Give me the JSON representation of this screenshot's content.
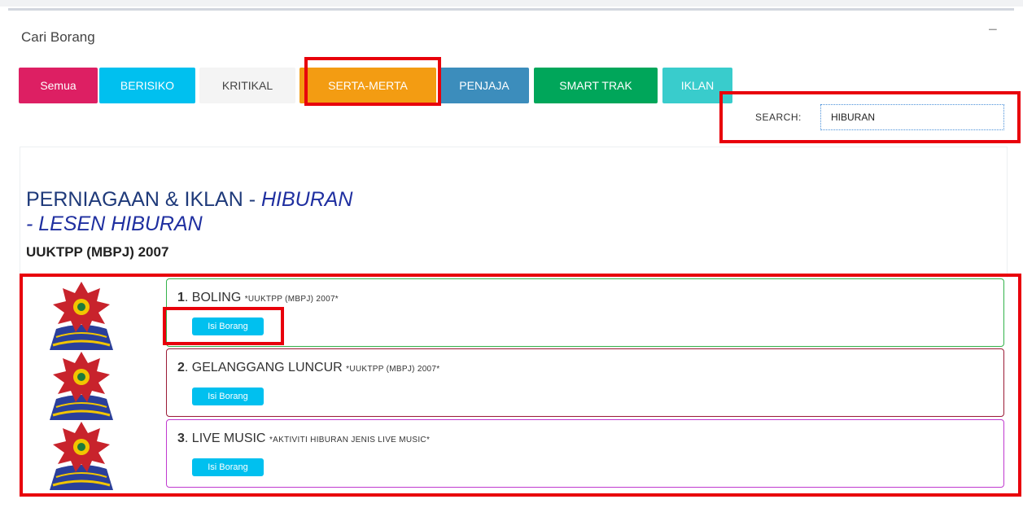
{
  "panel": {
    "title": "Cari Borang",
    "collapse_symbol": "−"
  },
  "tabs": [
    {
      "label": "Semua",
      "bg": "#dd1f63",
      "fg": "#ffffff"
    },
    {
      "label": "BERISIKO",
      "bg": "#00c0ef",
      "fg": "#ffffff"
    },
    {
      "label": "KRITIKAL",
      "bg": "#f4f4f4",
      "fg": "#444444"
    },
    {
      "label": "SERTA-MERTA",
      "bg": "#f39c12",
      "fg": "#ffffff"
    },
    {
      "label": "PENJAJA",
      "bg": "#3c8dbc",
      "fg": "#ffffff"
    },
    {
      "label": "SMART TRAK",
      "bg": "#00a65a",
      "fg": "#ffffff"
    },
    {
      "label": "IKLAN",
      "bg": "#39cccc",
      "fg": "#ffffff"
    }
  ],
  "search": {
    "label": "SEARCH:",
    "value": "HIBURAN"
  },
  "section": {
    "heading_prefix": "PERNIAGAAN & IKLAN - ",
    "heading_italic1": "HIBURAN",
    "heading_italic2": "- LESEN HIBURAN",
    "act": "UUKTPP (MBPJ) 2007"
  },
  "items": [
    {
      "number": "1",
      "name": ". BOLING ",
      "note": "*UUKTPP (MBPJ) 2007*",
      "button": "Isi Borang",
      "border": "#33b24a"
    },
    {
      "number": "2",
      "name": ". GELANGGANG LUNCUR ",
      "note": "*UUKTPP (MBPJ) 2007*",
      "button": "Isi Borang",
      "border": "#9b1b36"
    },
    {
      "number": "3",
      "name": ". LIVE MUSIC ",
      "note": "*AKTIVITI HIBURAN JENIS LIVE MUSIC*",
      "button": "Isi Borang",
      "border": "#c03ad0"
    }
  ],
  "colors": {
    "accent_highlight": "#e8000b",
    "heading": "#1f3a7a"
  }
}
